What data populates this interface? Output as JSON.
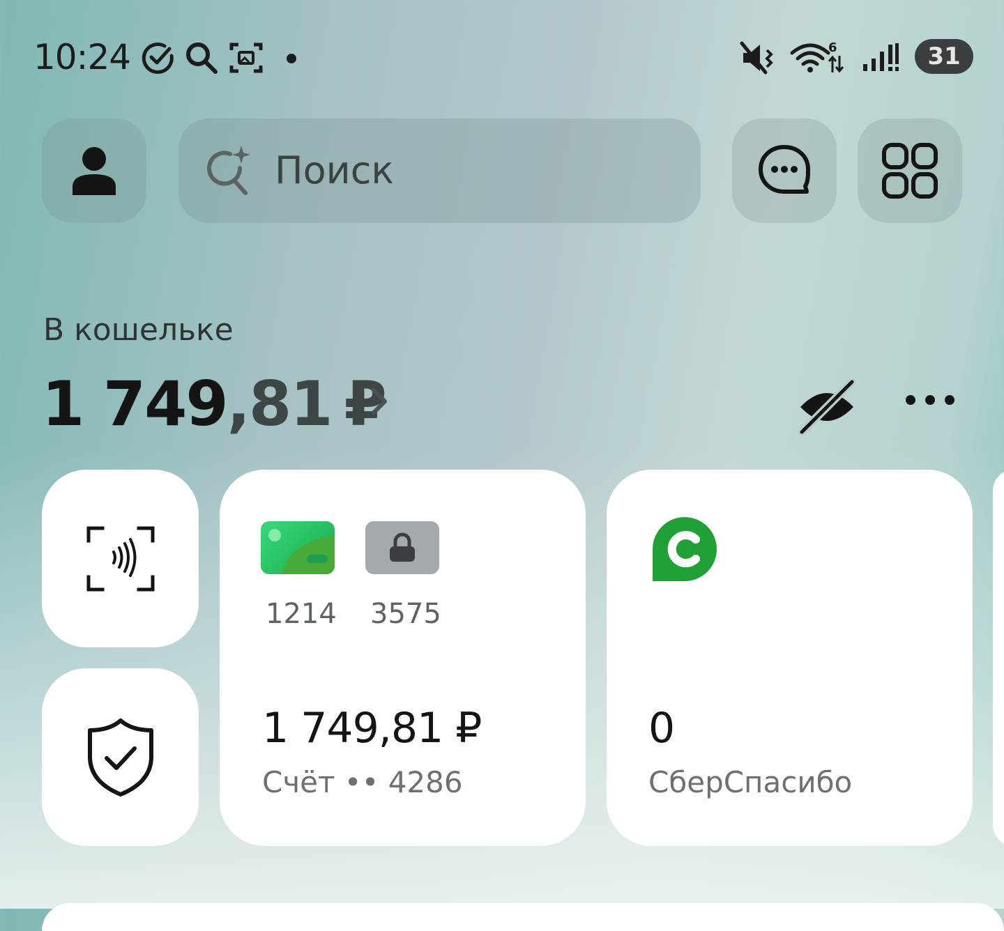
{
  "status_bar": {
    "time": "10:24",
    "battery": "31",
    "icons": [
      "check-circle-icon",
      "search-icon",
      "screenshot-icon",
      "mute-icon",
      "wifi-icon",
      "signal-icon"
    ]
  },
  "top_bar": {
    "search_placeholder": "Поиск",
    "icons": [
      "profile-icon",
      "ai-search-icon",
      "chat-icon",
      "apps-grid-icon"
    ]
  },
  "wallet": {
    "title": "В кошельке",
    "balance_int": "1 749",
    "balance_frac": ",81",
    "currency": "₽"
  },
  "cards": {
    "account": {
      "card1_number": "1214",
      "card2_number": "3575",
      "amount": "1 749,81 ₽",
      "label": "Счёт •• 4286"
    },
    "bonus": {
      "amount": "0",
      "label": "СберСпасибо"
    }
  },
  "colors": {
    "sber_green": "#21a038",
    "card_green": "#26c061"
  }
}
